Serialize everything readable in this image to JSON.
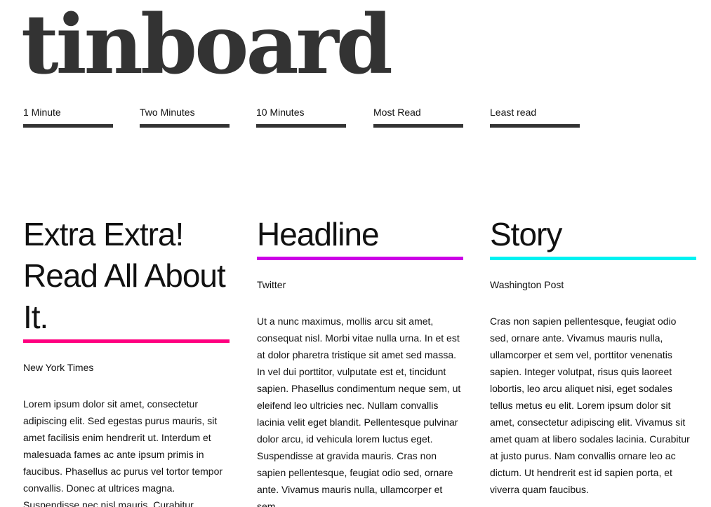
{
  "site": {
    "logo": "tinboard"
  },
  "nav": {
    "items": [
      {
        "label": "1 Minute"
      },
      {
        "label": "Two Minutes"
      },
      {
        "label": "10 Minutes"
      },
      {
        "label": "Most Read"
      },
      {
        "label": "Least read"
      }
    ]
  },
  "colors": {
    "text": "#111111",
    "logo": "#333333",
    "nav_underline": "#333333",
    "accent_1": "#ff0080",
    "accent_2": "#cc00e6",
    "accent_3": "#00f2f2"
  },
  "articles": [
    {
      "headline": "Extra Extra! Read All About It.",
      "source": "New York Times",
      "body": "Lorem ipsum dolor sit amet, consectetur adipiscing elit. Sed egestas purus mauris, sit amet facilisis enim hendrerit ut. Interdum et malesuada fames ac ante ipsum primis in faucibus. Phasellus ac purus vel tortor tempor convallis. Donec at ultrices magna. Suspendisse nec nisl mauris. Curabitur"
    },
    {
      "headline": "Headline",
      "source": "Twitter",
      "body": "Ut a nunc maximus, mollis arcu sit amet, consequat nisl. Morbi vitae nulla urna. In et est at dolor pharetra tristique sit amet sed massa. In vel dui porttitor, vulputate est et, tincidunt sapien. Phasellus condimentum neque sem, ut eleifend leo ultricies nec. Nullam convallis lacinia velit eget blandit. Pellentesque pulvinar dolor arcu, id vehicula lorem luctus eget. Suspendisse at gravida mauris. Cras non sapien pellentesque, feugiat odio sed, ornare ante. Vivamus mauris nulla, ullamcorper et sem"
    },
    {
      "headline": "Story",
      "source": "Washington Post",
      "body": "Cras non sapien pellentesque, feugiat odio sed, ornare ante. Vivamus mauris nulla, ullamcorper et sem vel, porttitor venenatis sapien. Integer volutpat, risus quis laoreet lobortis, leo arcu aliquet nisi, eget sodales tellus metus eu elit. Lorem ipsum dolor sit amet, consectetur adipiscing elit. Vivamus sit amet quam at libero sodales lacinia. Curabitur at justo purus. Nam convallis ornare leo ac dictum. Ut hendrerit est id sapien porta, et viverra quam faucibus."
    }
  ]
}
